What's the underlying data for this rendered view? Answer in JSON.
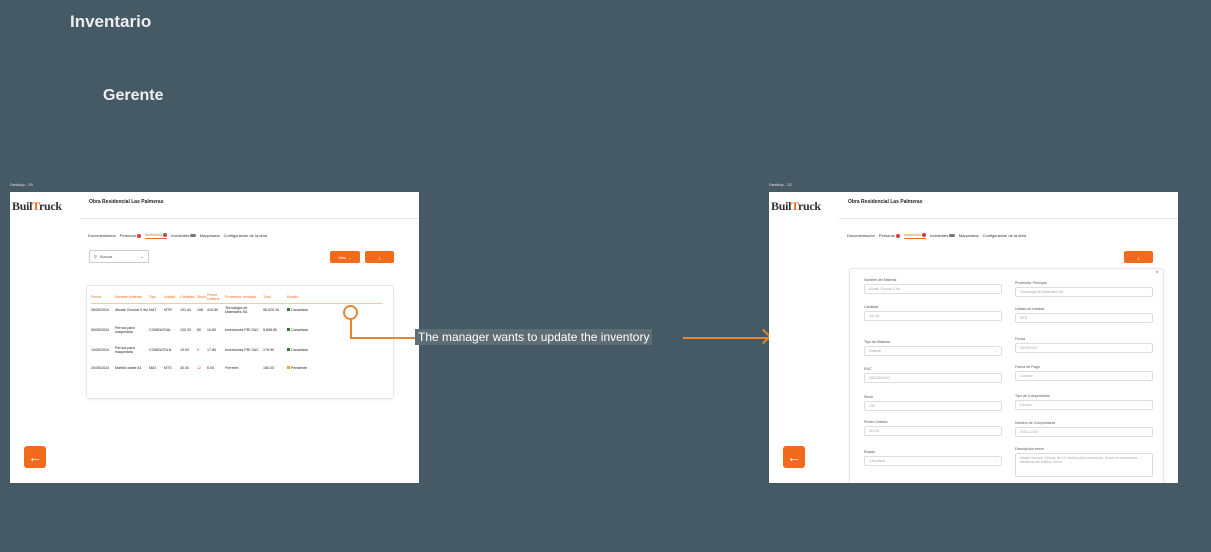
{
  "page_title": "Inventario",
  "section_title": "Gerente",
  "annotation": "The manager wants to update the inventory",
  "left_frame": {
    "label": "Desktop - 29",
    "logo": {
      "pre": "Buil",
      "t": "T",
      "post": "ruck"
    },
    "project_title": "Obra Residencial Las Palmeras",
    "tabs": [
      "Documentación",
      "Personal",
      "Inventario",
      "Incidentes",
      "Maquinaria",
      "Configuración de la obra"
    ],
    "search_placeholder": "Buscar",
    "filter_label": "Mes",
    "columns": [
      "Fecha",
      "Nombre Material",
      "Tipo",
      "Unidad",
      "Cantidad",
      "Stock",
      "Precio Unitario",
      "Proveedor principal",
      "Total",
      "Estado"
    ],
    "rows": [
      {
        "fecha": "08/05/2024",
        "nombre": "Alicate Circular 0.9m",
        "tipo": "MAT",
        "unidad": "MTR",
        "cantidad": "101.44",
        "stock": "108",
        "precio": "410.80",
        "proveedor": "Tecnología de Materiales SA",
        "total": "96,529.18",
        "estado": "Cancelado"
      },
      {
        "fecha": "06/05/2024",
        "nombre": "Pernos para maquinaria",
        "tipo": "COMBUST",
        "unidad": "GAL",
        "cantidad": "100.00",
        "stock": "80",
        "precio": "10.80",
        "proveedor": "Inversiones PRI SAC",
        "total": "5,898.80",
        "estado": "Cancelado"
      },
      {
        "fecha": "14/05/2024",
        "nombre": "Pernos para maquinaria",
        "tipo": "COMBUST",
        "unidad": "GLN",
        "cantidad": "10.00",
        "stock": "5",
        "precio": "17.89",
        "proveedor": "Inversiones PRI SAC",
        "total": "176.90",
        "estado": "Cancelado"
      },
      {
        "fecha": "20/05/2024",
        "nombre": "Martillo doble A1",
        "tipo": "MAT",
        "unidad": "MTS",
        "cantidad": "30.00",
        "stock": "12",
        "precio": "6.00",
        "proveedor": "Ferretex",
        "total": "180.00",
        "estado": "Pendiente"
      }
    ]
  },
  "right_frame": {
    "label": "Desktop - 32",
    "logo": {
      "pre": "Buil",
      "t": "T",
      "post": "ruck"
    },
    "project_title": "Obra Residencial Las Palmeras",
    "tabs": [
      "Documentación",
      "Personal",
      "Inventario",
      "Incidentes",
      "Maquinaria",
      "Configuración de la obra"
    ],
    "form_left": [
      {
        "label": "Nombre del Material",
        "value": "Alicate Circular 0.9m",
        "select": false
      },
      {
        "label": "Cantidad",
        "value": "101.44",
        "select": false
      },
      {
        "label": "Tipo de Material",
        "value": "Material",
        "select": true
      },
      {
        "label": "RUC",
        "value": "20512500463",
        "select": false
      },
      {
        "label": "Stock",
        "value": "108",
        "select": false
      },
      {
        "label": "Precio Unitario",
        "value": "410.80",
        "select": false
      },
      {
        "label": "Estado",
        "value": "Cancelado",
        "select": true
      }
    ],
    "form_right": [
      {
        "label": "Proveedor Principal",
        "value": "Tecnología de Materiales SA",
        "select": false
      },
      {
        "label": "Unidad de medida",
        "value": "MTR",
        "select": false
      },
      {
        "label": "Fecha",
        "value": "08/05/2024",
        "select": true
      },
      {
        "label": "Forma de Pago",
        "value": "Contado",
        "select": true
      },
      {
        "label": "Tipo de Comprobante",
        "value": "Factura",
        "select": true
      },
      {
        "label": "Número de Comprobante",
        "value": "F001-12234",
        "select": false
      },
      {
        "label": "Descripción breve",
        "value": "Alicate Sección Circular de 0.9 metros para estructuras. Usado en estructuras metálicas del Edificio Torres.",
        "select": false
      }
    ]
  },
  "colors": {
    "background": "#455a64",
    "accent": "#f26b1d",
    "annotation_arrow": "#e8862f"
  },
  "icons": {
    "back": "arrow-left-icon",
    "download": "download-icon",
    "search": "search-icon",
    "close": "close-icon"
  }
}
